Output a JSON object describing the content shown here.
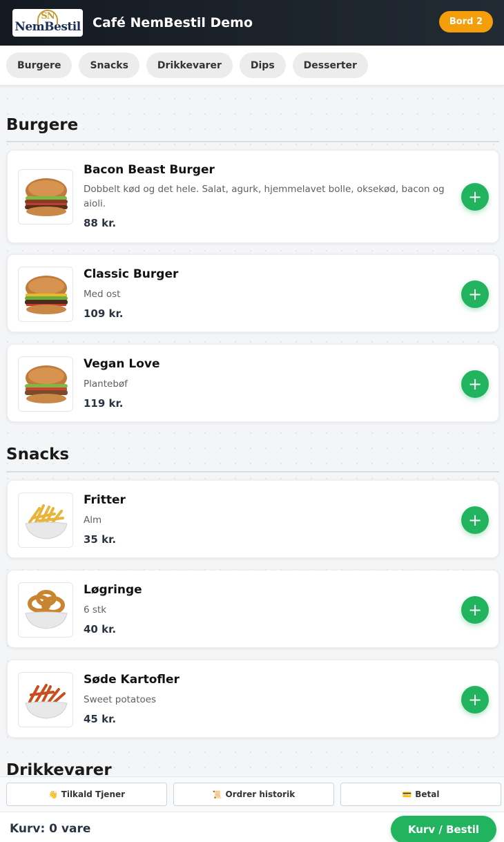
{
  "header": {
    "logo_monogram": "SN",
    "logo_text": "NemBestil",
    "title": "Café NemBestil Demo",
    "table_badge": "Bord 2"
  },
  "tabs": [
    "Burgere",
    "Snacks",
    "Drikkevarer",
    "Dips",
    "Desserter"
  ],
  "sections": [
    {
      "title": "Burgere",
      "items": [
        {
          "name": "Bacon Beast Burger",
          "desc": "Dobbelt kød og det hele. Salat, agurk, hjemmelavet bolle, oksekød, bacon og aioli.",
          "price": "88 kr.",
          "image": "burger-image"
        },
        {
          "name": "Classic Burger",
          "desc": "Med ost",
          "price": "109 kr.",
          "image": "burger-image"
        },
        {
          "name": "Vegan Love",
          "desc": "Plantebøf",
          "price": "119 kr.",
          "image": "burger-image"
        }
      ]
    },
    {
      "title": "Snacks",
      "items": [
        {
          "name": "Fritter",
          "desc": "Alm",
          "price": "35 kr.",
          "image": "fries-image"
        },
        {
          "name": "Løgringe",
          "desc": "6 stk",
          "price": "40 kr.",
          "image": "onion-rings-image"
        },
        {
          "name": "Søde Kartofler",
          "desc": "Sweet potatoes",
          "price": "45 kr.",
          "image": "sweet-potato-fries-image"
        }
      ]
    },
    {
      "title": "Drikkevarer",
      "items": []
    }
  ],
  "add_label": "+",
  "footer": {
    "actions": [
      {
        "icon": "👋",
        "label": "Tilkald Tjener"
      },
      {
        "icon": "📜",
        "label": "Ordrer historik"
      },
      {
        "icon": "💳",
        "label": "Betal"
      }
    ],
    "cart_count": "Kurv: 0 vare",
    "cart_button": "Kurv / Bestil"
  },
  "colors": {
    "accent_green": "#22b35e",
    "badge_orange": "#f59e0b",
    "header_dark": "#141a21"
  }
}
